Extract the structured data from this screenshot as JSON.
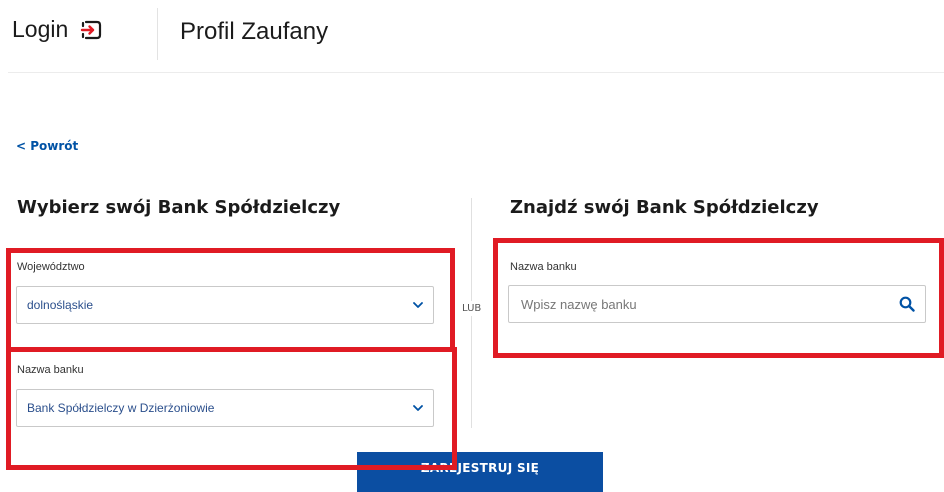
{
  "header": {
    "logo_text": "Login",
    "title": "Profil Zaufany"
  },
  "back_link": "< Powrót",
  "lub_label": "LUB",
  "left": {
    "title": "Wybierz swój Bank Spółdzielczy",
    "voivodeship_label": "Województwo",
    "voivodeship_value": "dolnośląskie",
    "bank_label": "Nazwa banku",
    "bank_value": "Bank Spółdzielczy w Dzierżoniowie"
  },
  "right": {
    "title": "Znajdź swój Bank Spółdzielczy",
    "bank_label": "Nazwa banku",
    "bank_placeholder": "Wpisz nazwę banku"
  },
  "register_button": "ZAREJESTRUJ SIĘ",
  "colors": {
    "accent": "#0b4ea2",
    "highlight": "#e01b24"
  },
  "icons": [
    "login-icon",
    "chevron-down-icon",
    "search-icon"
  ]
}
